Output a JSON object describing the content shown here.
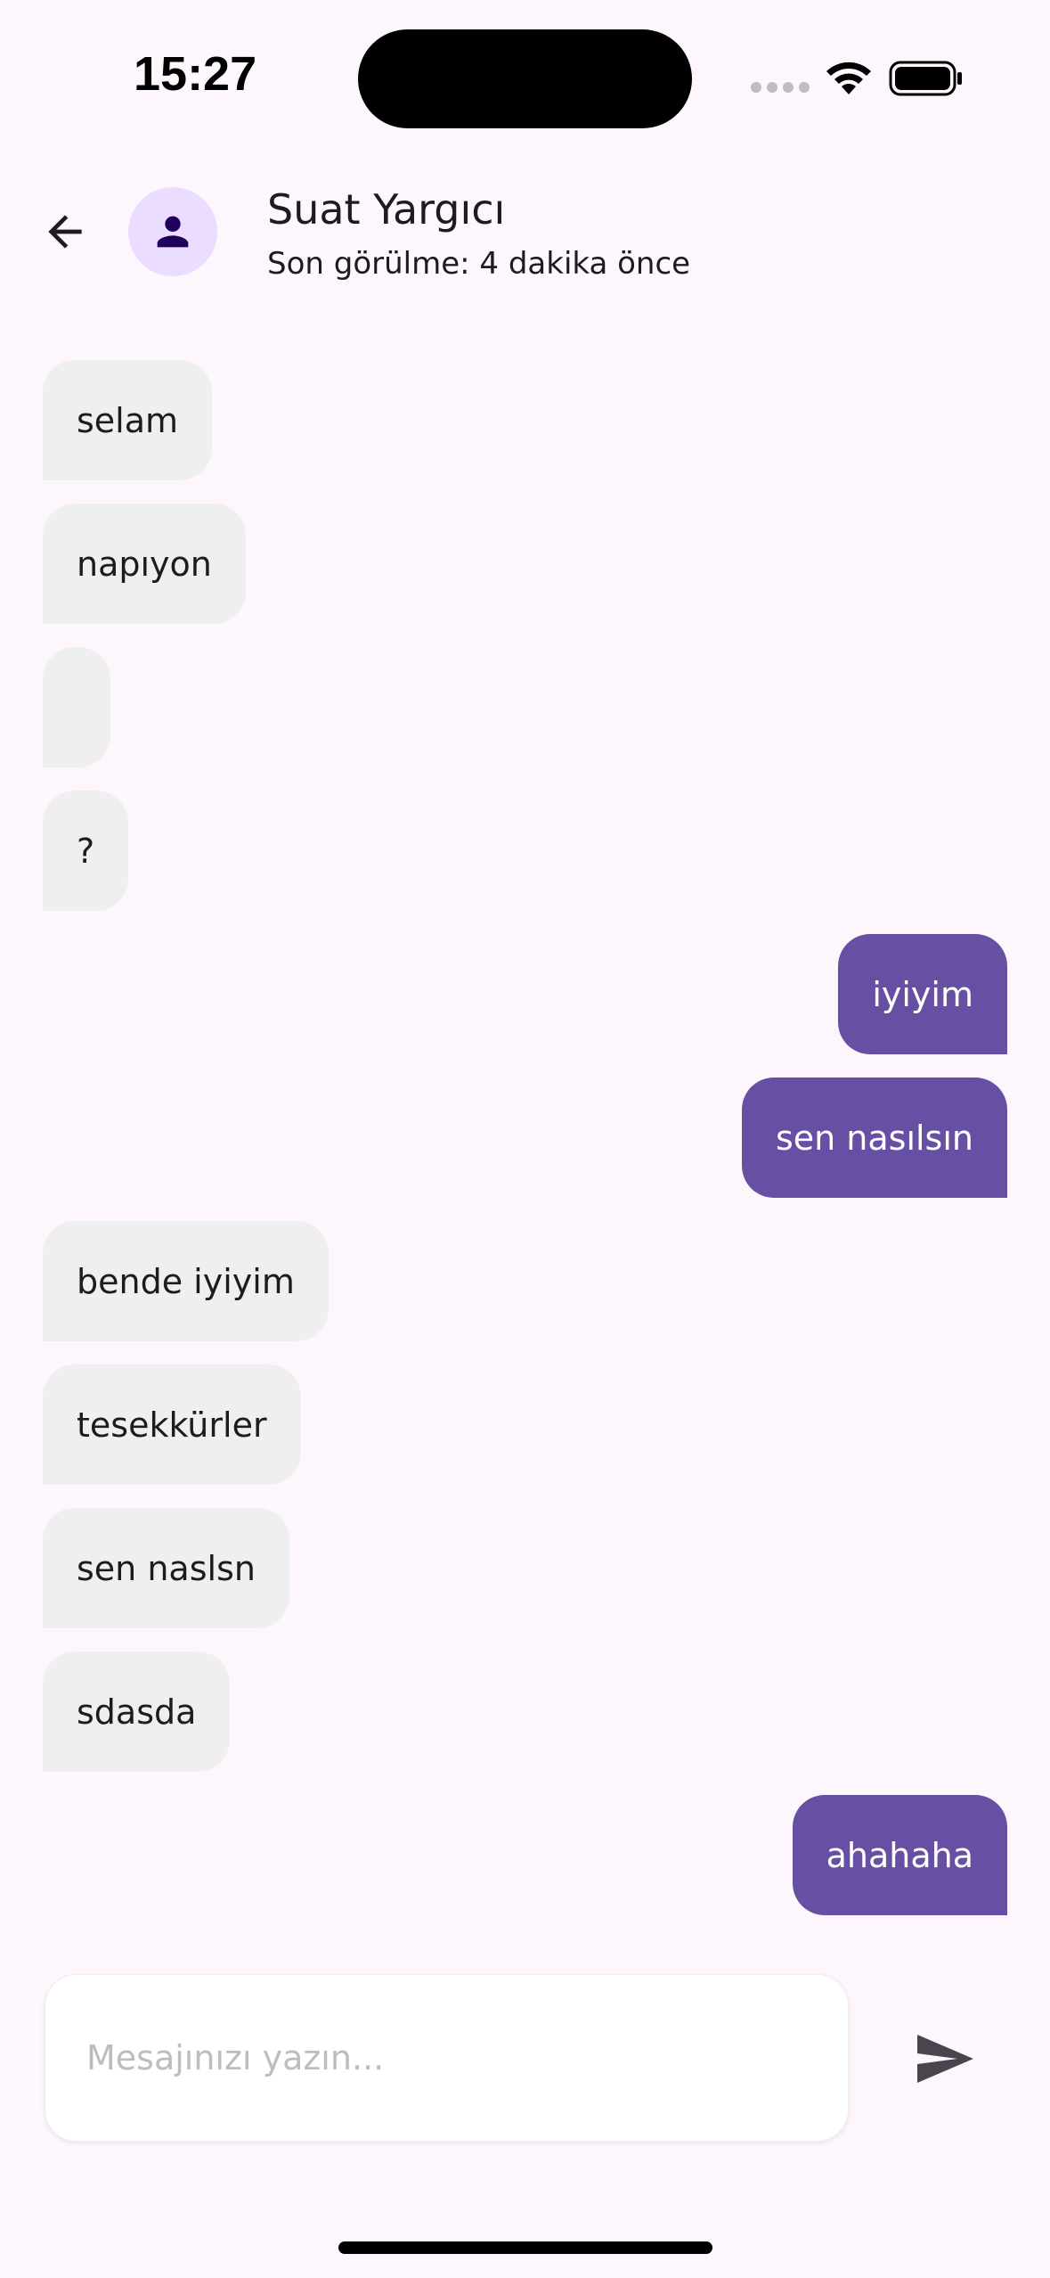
{
  "status_bar": {
    "time": "15:27"
  },
  "header": {
    "contact_name": "Suat Yargıcı",
    "last_seen": "Son görülme: 4 dakika önce"
  },
  "messages": [
    {
      "text": "selam",
      "direction": "in"
    },
    {
      "text": "napıyon",
      "direction": "in"
    },
    {
      "text": "",
      "direction": "in"
    },
    {
      "text": "?",
      "direction": "in"
    },
    {
      "text": "iyiyim",
      "direction": "out"
    },
    {
      "text": "sen nasılsın",
      "direction": "out"
    },
    {
      "text": "bende iyiyim",
      "direction": "in"
    },
    {
      "text": "tesekkürler",
      "direction": "in"
    },
    {
      "text": "sen naslsn",
      "direction": "in"
    },
    {
      "text": "sdasda",
      "direction": "in"
    },
    {
      "text": "ahahaha",
      "direction": "out"
    }
  ],
  "composer": {
    "placeholder": "Mesajınızı yazın...",
    "value": ""
  },
  "colors": {
    "background": "#FDF7FD",
    "incoming_bubble": "#EFEFEF",
    "outgoing_bubble": "#6750A4",
    "avatar_bg": "#EADDFF",
    "avatar_icon": "#21005D"
  },
  "icons": {
    "back": "arrow-back-icon",
    "avatar": "person-icon",
    "send": "send-icon",
    "wifi": "wifi-icon",
    "battery": "battery-icon"
  }
}
